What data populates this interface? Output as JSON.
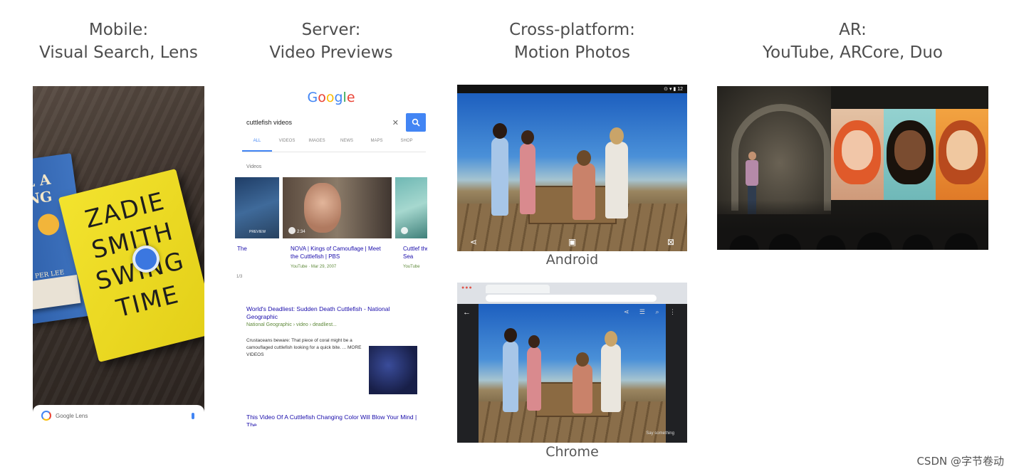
{
  "columns": [
    {
      "line1": "Mobile:",
      "line2": "Visual Search, Lens"
    },
    {
      "line1": "Server:",
      "line2": "Video Previews"
    },
    {
      "line1": "Cross-platform:",
      "line2": "Motion Photos"
    },
    {
      "line1": "AR:",
      "line2": "YouTube, ARCore, Duo"
    }
  ],
  "lens": {
    "book_blue_text": "L A\nNG",
    "book_blue_bottom": "PER LEE",
    "book_yellow_text": "ZADIE\nSMITH\nSWING\nTIME",
    "bar_label": "Google Lens"
  },
  "search": {
    "logo_letters": [
      {
        "ch": "G",
        "color": "#4285F4"
      },
      {
        "ch": "o",
        "color": "#EA4335"
      },
      {
        "ch": "o",
        "color": "#FBBC05"
      },
      {
        "ch": "g",
        "color": "#4285F4"
      },
      {
        "ch": "l",
        "color": "#34A853"
      },
      {
        "ch": "e",
        "color": "#EA4335"
      }
    ],
    "query": "cuttlefish videos",
    "tabs": [
      "ALL",
      "VIDEOS",
      "IMAGES",
      "NEWS",
      "MAPS",
      "SHOP"
    ],
    "videos_label": "Videos",
    "video_1_title": "The",
    "video_1_badge": "PREVIEW",
    "video_2_title": "NOVA | Kings of Camouflage | Meet the Cuttlefish | PBS",
    "video_2_source": "YouTube · Mar 29, 2007",
    "video_2_duration": "2:34",
    "video_3_title": "Cuttlef the Sea",
    "video_3_source": "YouTube",
    "video_count": "1/3",
    "result_1_title": "World's Deadliest: Sudden Death Cuttlefish - National Geographic",
    "result_1_source": "National Geographic › video › deadliest...",
    "result_1_snippet": "Crustaceans beware: That piece of coral might be a camouflaged cuttlefish looking for a quick bite. ... MORE VIDEOS",
    "result_2_title": "This Video Of A Cuttlefish Changing Color Will Blow Your Mind | The"
  },
  "motion": {
    "android_label": "Android",
    "chrome_label": "Chrome",
    "chrome_overlay_text": "Say something"
  },
  "watermark": "CSDN @字节卷动",
  "colors": {
    "google_blue": "#4285F4",
    "link_blue": "#1a0dab",
    "url_green": "#5f8a3b"
  }
}
